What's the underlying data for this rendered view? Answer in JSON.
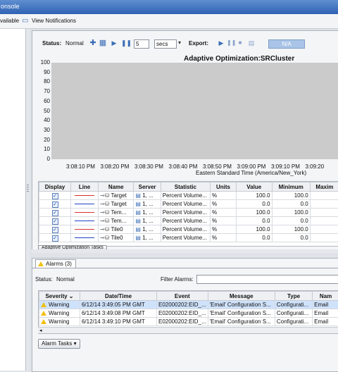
{
  "window": {
    "title": "onsole"
  },
  "menubar": {
    "left_item": "vailable",
    "view_notifications": "View Notifications"
  },
  "toolbar": {
    "status_label": "Status:",
    "status_value": "Normal",
    "interval_value": "5",
    "interval_unit": "secs",
    "export_label": "Export:",
    "na_label": "N/A"
  },
  "chart": {
    "title": "Adaptive Optimization:SRCluster",
    "xlabel": "Eastern Standard Time (America/New_York)"
  },
  "chart_data": {
    "type": "line",
    "title": "Adaptive Optimization:SRCluster",
    "xlabel": "Eastern Standard Time (America/New_York)",
    "ylabel": "",
    "ylim": [
      0,
      100
    ],
    "yticks": [
      "100",
      "90",
      "80",
      "70",
      "60",
      "50",
      "40",
      "30",
      "20",
      "10",
      "0"
    ],
    "xticks": [
      "3:08:10 PM",
      "3:08:20 PM",
      "3:08:30 PM",
      "3:08:40 PM",
      "3:08:50 PM",
      "3:09:00 PM",
      "3:09:10 PM",
      "3:09:20"
    ],
    "series": [],
    "grid": false
  },
  "metrics_table": {
    "headers": [
      "Display",
      "Line",
      "Name",
      "Server",
      "Statistic",
      "Units",
      "Value",
      "Minimum",
      "Maxim"
    ],
    "rows": [
      {
        "line_color": "#d83030",
        "name": "Target",
        "server": "1, ...",
        "statistic": "Percent Volume...",
        "units": "%",
        "value": "100.0",
        "minimum": "100.0"
      },
      {
        "line_color": "#2040c8",
        "name": "Target",
        "server": "1, ...",
        "statistic": "Percent Volume...",
        "units": "%",
        "value": "0.0",
        "minimum": "0.0"
      },
      {
        "line_color": "#d83030",
        "name": "Tem...",
        "server": "1, ...",
        "statistic": "Percent Volume...",
        "units": "%",
        "value": "100.0",
        "minimum": "100.0"
      },
      {
        "line_color": "#2040c8",
        "name": "Tem...",
        "server": "1, ...",
        "statistic": "Percent Volume...",
        "units": "%",
        "value": "0.0",
        "minimum": "0.0"
      },
      {
        "line_color": "#d83030",
        "name": "Tile0",
        "server": "1, ...",
        "statistic": "Percent Volume...",
        "units": "%",
        "value": "100.0",
        "minimum": "100.0"
      },
      {
        "line_color": "#2040c8",
        "name": "Tile0",
        "server": "1, ...",
        "statistic": "Percent Volume...",
        "units": "%",
        "value": "0.0",
        "minimum": "0.0"
      }
    ],
    "tasks_button": "Adaptive Optimization Tasks"
  },
  "alarms": {
    "tab_label": "Alarms (3)",
    "status_label": "Status:",
    "status_value": "Normal",
    "filter_label": "Filter Alarms:",
    "headers": [
      "Severity",
      "Date/Time",
      "Event",
      "Message",
      "Type",
      "Nam"
    ],
    "rows": [
      {
        "severity": "Warning",
        "datetime": "6/12/14 3:49:05 PM GMT",
        "event": "E02000202:EID_...",
        "message": "'Email' Configuration S...",
        "type": "Configurati...",
        "name": "Email"
      },
      {
        "severity": "Warning",
        "datetime": "6/12/14 3:49:08 PM GMT",
        "event": "E02000202:EID_...",
        "message": "'Email' Configuration S...",
        "type": "Configurati...",
        "name": "Email"
      },
      {
        "severity": "Warning",
        "datetime": "6/12/14 3:49:10 PM GMT",
        "event": "E02000202:EID_...",
        "message": "'Email' Configuration S...",
        "type": "Configurati...",
        "name": "Email"
      }
    ],
    "tasks_button": "Alarm Tasks"
  }
}
